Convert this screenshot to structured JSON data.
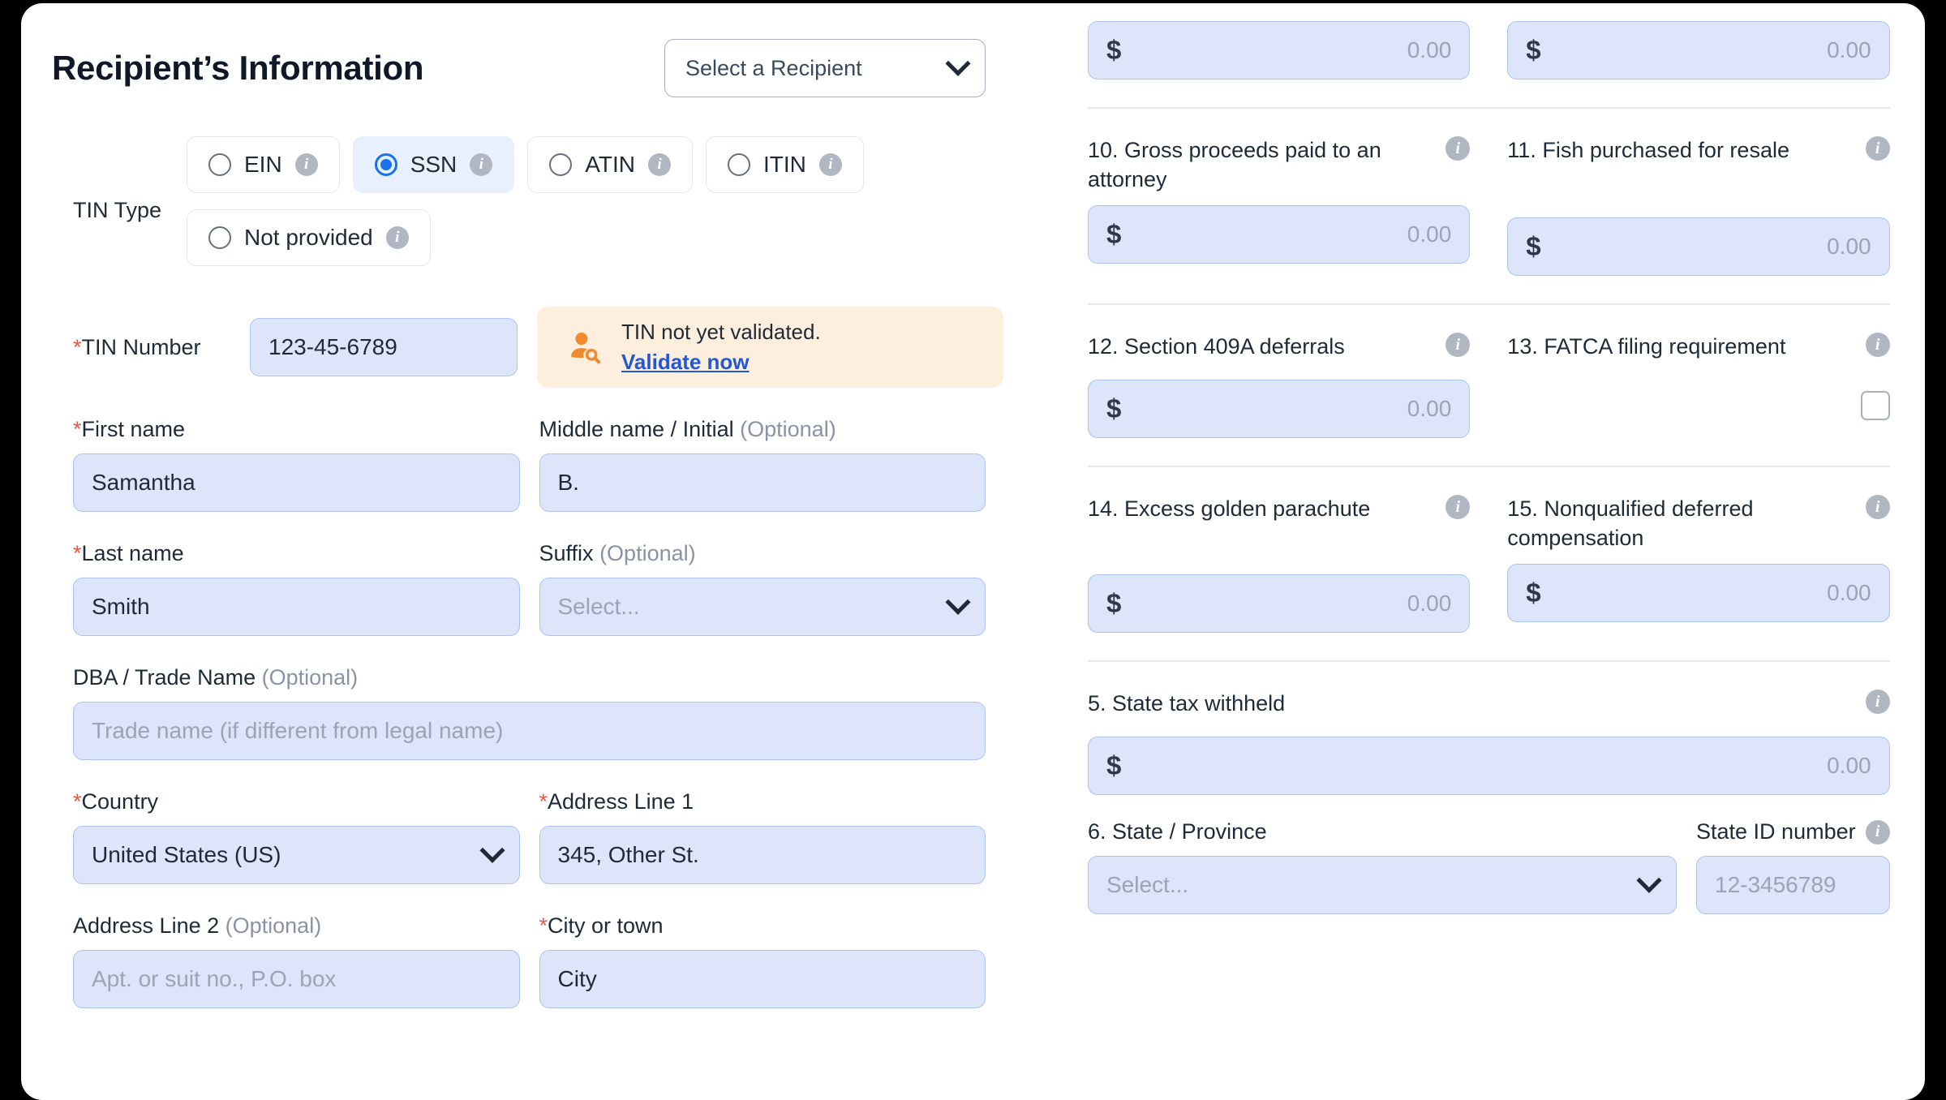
{
  "left": {
    "title": "Recipient’s Information",
    "recipient_select": {
      "value": "Select a Recipient",
      "icon": "chevron-down-icon"
    },
    "tin_type": {
      "label": "TIN Type",
      "options": [
        {
          "label": "EIN",
          "selected": false
        },
        {
          "label": "SSN",
          "selected": true
        },
        {
          "label": "ATIN",
          "selected": false
        },
        {
          "label": "ITIN",
          "selected": false
        },
        {
          "label": "Not provided",
          "selected": false
        }
      ]
    },
    "tin_number": {
      "label": "TIN Number",
      "required": "*",
      "value": "123-45-6789"
    },
    "tin_alert": {
      "icon": "user-search-icon",
      "message": "TIN not yet validated.",
      "link": "Validate now"
    },
    "first_name": {
      "label": "First name",
      "required": "*",
      "value": "Samantha"
    },
    "middle_name": {
      "label": "Middle name / Initial",
      "optional": "(Optional)",
      "value": "B."
    },
    "last_name": {
      "label": "Last name",
      "required": "*",
      "value": "Smith"
    },
    "suffix": {
      "label": "Suffix",
      "optional": "(Optional)",
      "value": "Select...",
      "icon": "chevron-down-icon"
    },
    "dba": {
      "label": "DBA / Trade Name",
      "optional": "(Optional)",
      "placeholder": "Trade name (if different from legal name)"
    },
    "country": {
      "label": "Country",
      "required": "*",
      "value": "United States (US)",
      "icon": "chevron-down-icon"
    },
    "address1": {
      "label": "Address Line 1",
      "required": "*",
      "value": "345, Other St."
    },
    "address2": {
      "label": "Address Line 2",
      "optional": "(Optional)",
      "placeholder": "Apt. or suit no., P.O. box"
    },
    "city": {
      "label": "City or town",
      "required": "*",
      "value": "City"
    }
  },
  "right": {
    "top_money": [
      {
        "currency": "$",
        "amount": "0.00"
      },
      {
        "currency": "$",
        "amount": "0.00"
      }
    ],
    "boxes": [
      {
        "number": "10.",
        "label": "10. Gross proceeds paid to an attorney",
        "info": "info-icon",
        "currency": "$",
        "amount": "0.00"
      },
      {
        "number": "11.",
        "label": "11. Fish purchased for resale",
        "info": "info-icon",
        "currency": "$",
        "amount": "0.00"
      },
      {
        "number": "12.",
        "label": "12. Section 409A deferrals",
        "info": "info-icon",
        "currency": "$",
        "amount": "0.00"
      },
      {
        "number": "13.",
        "label": "13. FATCA filing requirement",
        "info": "info-icon",
        "checkbox": true,
        "checked": false
      },
      {
        "number": "14.",
        "label": "14. Excess golden parachute",
        "info": "info-icon",
        "currency": "$",
        "amount": "0.00"
      },
      {
        "number": "15.",
        "label": "15. Nonqualified deferred compensation",
        "info": "info-icon",
        "currency": "$",
        "amount": "0.00"
      }
    ],
    "state_tax": {
      "label": "5. State tax withheld",
      "info": "info-icon",
      "currency": "$",
      "amount": "0.00"
    },
    "state_province": {
      "label": "6. State / Province",
      "value": "Select...",
      "icon": "chevron-down-icon"
    },
    "state_id": {
      "label": "State ID number",
      "info": "info-icon",
      "placeholder": "12-3456789"
    }
  },
  "colors": {
    "field_bg": "#dce5fa",
    "field_border": "#aec3f2",
    "accent": "#1a73e8",
    "alert_bg": "#fdeedd",
    "alert_icon": "#f08a2e",
    "link": "#2457d6",
    "required": "#e8584c",
    "divider": "#e4e7ec"
  }
}
